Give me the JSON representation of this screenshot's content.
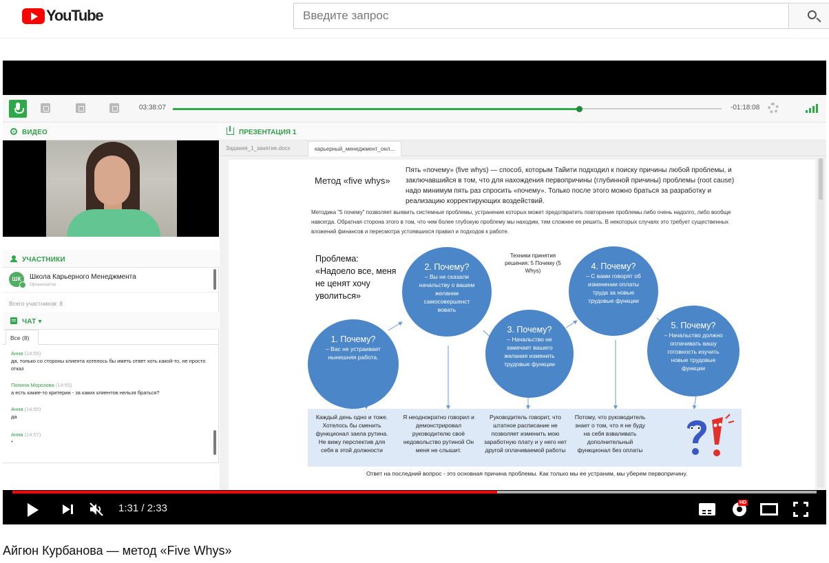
{
  "header": {
    "logo_text": "YouTube",
    "search_placeholder": "Введите запрос"
  },
  "webinar": {
    "toolbar": {
      "elapsed": "03:38:07",
      "remaining": "-01:18:08",
      "progress": 0.74
    },
    "video_section_title": "ВИДЕО",
    "participants": {
      "title": "УЧАСТНИКИ",
      "items": [
        {
          "initials": "ШК",
          "name": "Школа Карьерного Менеджмента",
          "role": "Организатор"
        }
      ],
      "total": "Всего участников: 8"
    },
    "chat": {
      "title": "ЧАТ",
      "tab": "Все (8)",
      "messages": [
        {
          "author": "Анна",
          "time": "(14:55)",
          "text": "да, только со стороны клиента хотелось бы иметь ответ хоть какой-то, не просто отказ"
        },
        {
          "author": "Полина Морозова",
          "time": "(14:55)",
          "text": "а есть какие-то критерии - за каких клиентов нельзя браться?"
        },
        {
          "author": "Анна",
          "time": "(14:55)",
          "text": "да"
        },
        {
          "author": "Анна",
          "time": "(14:57)",
          "text": "*"
        }
      ]
    },
    "presentation": {
      "title": "ПРЕЗЕНТАЦИЯ 1",
      "tabs": [
        "Задания_1_занятие.docx",
        "карьерный_менеджмент_онл..."
      ],
      "active_tab": 1
    }
  },
  "slide": {
    "title": "Метод «five whys»",
    "intro": "Пять «почему» (five whys) — способ, которым Тайити подходил к поиску причины любой проблемы, и заключавшийся в том, что для нахождения первопричины (глубинной причины) проблемы (root cause) надо минимум пять раз спросить «почему». Только после этого можно браться за разработку и реализацию корректирующих воздействий.",
    "description": "Методика \"5 почему\" позволяет выявить системные проблемы, устранение которых может предотвратить повторение проблемы либо очень надолго, либо вообще навсегда. Обратная сторона этого в том, что чем более глубокую проблему мы находим, тем сложнее ее решить. В некоторых случаях это требует существенных вложений финансов и пересмотра устоявшихся правил и подходов к работе.",
    "problem": "Проблема: «Надоело все, меня не ценят хочу уволиться»",
    "technique": "Техники принятия решения: 5 Почему (5 Whys)",
    "whys": [
      {
        "q": "1. Почему?",
        "a": "– Вас не устраивает нынешняя работа."
      },
      {
        "q": "2. Почему?",
        "a": "– Вы не сказали начальству о вашем желании самосовершенст вовать"
      },
      {
        "q": "3. Почему?",
        "a": "– Начальство не замечает вашего желания изменить трудовые функции"
      },
      {
        "q": "4. Почему?",
        "a": "– С вами говорят об изменении оплаты труда за новые трудовые функции"
      },
      {
        "q": "5. Почему?",
        "a": "– Начальство должно оплачивать вашу готовность изучить новые трудовые функции"
      }
    ],
    "answers": [
      "Каждый день одно и тоже. Хотелось бы сменить функционал заела рутина. Не вижу перспектив для себя в этой должности",
      "Я неоднократно говорил и демонстрировал руководителю своё недовольство рутиной Он меня не слышит.",
      "Руководитель говорит, что штатное расписание не позволяет изменить мою заработную плату и у него нет другой оплачиваемой работы",
      "Потому, что руководитель знает о том, что я не буду на себя взваливать дополнительный функционал без оплаты"
    ],
    "footer": "Ответ на последний вопрос - это основная причина проблемы. Как только мы ее устраним, мы уберем первопричину."
  },
  "player": {
    "current_time": "1:31",
    "duration": "2:33",
    "played_fraction": 0.603,
    "buffered_fraction": 1.0,
    "hd_badge": "HD"
  },
  "video_title": "Айгюн Курбанова — метод «Five Whys»",
  "colors": {
    "accent_green": "#2ea94a",
    "circle_blue": "#4a86c8",
    "yt_red": "#ff0000"
  }
}
